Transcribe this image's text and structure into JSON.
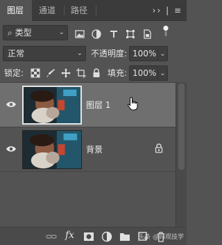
{
  "tabs": [
    {
      "label": "图层",
      "active": true
    },
    {
      "label": "通道",
      "active": false
    },
    {
      "label": "路径",
      "active": false
    }
  ],
  "tabbar": {
    "menu": "›› | ≡"
  },
  "filter": {
    "kind_label": "类型",
    "kind_prefix": "⌕"
  },
  "blend": {
    "mode": "正常",
    "opacity_label": "不透明度:",
    "opacity_value": "100%"
  },
  "lock": {
    "label": "锁定:",
    "fill_label": "填充:",
    "fill_value": "100%"
  },
  "layers": [
    {
      "name": "图层 1",
      "visible": true,
      "selected": true,
      "locked": false
    },
    {
      "name": "背景",
      "visible": true,
      "selected": false,
      "locked": true
    }
  ],
  "bottom": {
    "fx_label": "fx",
    "watermark": "头条 @码观技学"
  },
  "colors": {
    "panel_bg": "#535353",
    "selected_bg": "#6f6f6f",
    "tabbar_bg": "#3b3b3b"
  }
}
